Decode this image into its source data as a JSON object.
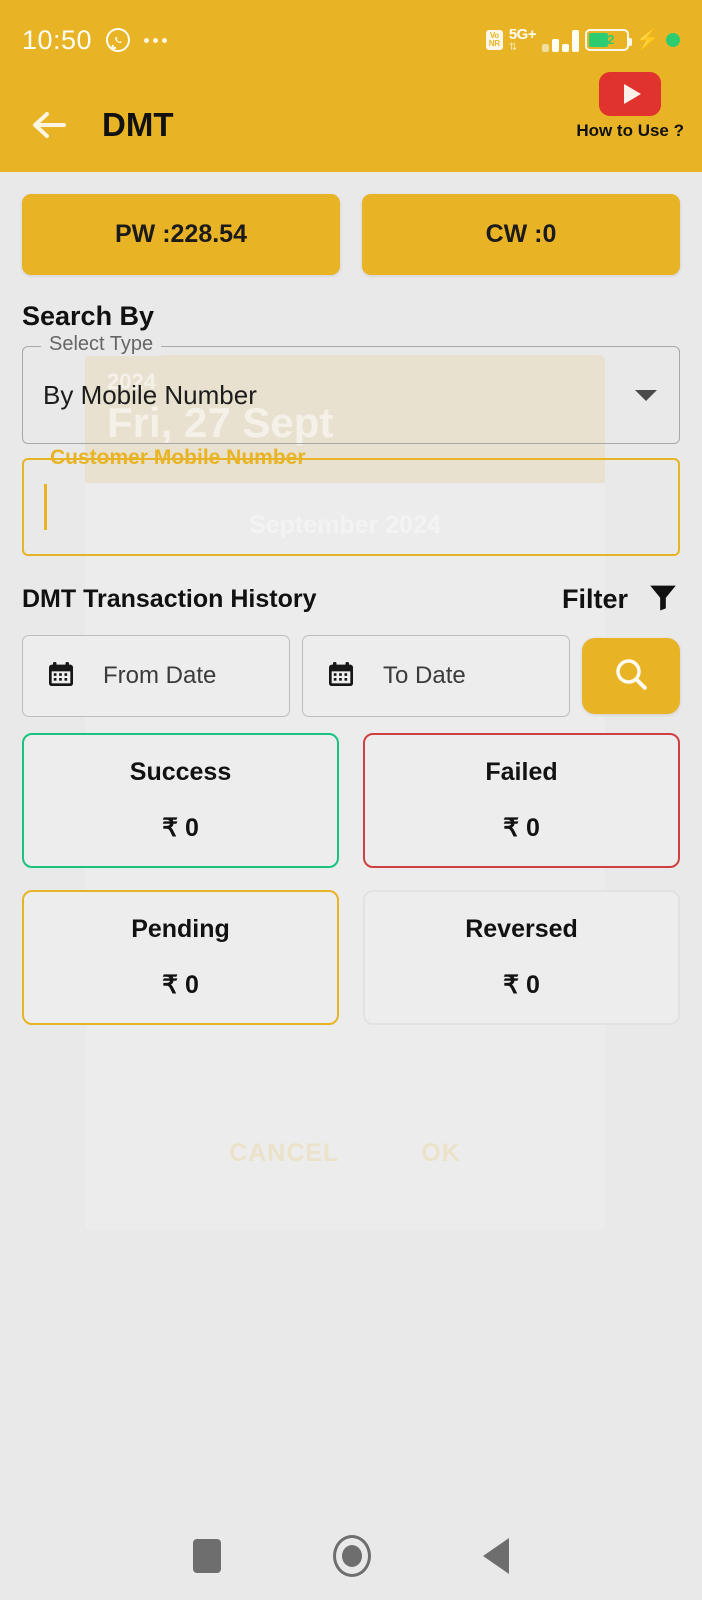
{
  "status_bar": {
    "time": "10:50",
    "whatsapp_icon": "whatsapp-icon",
    "more_icon": "more-dots-icon",
    "vonr_line1": "Vo",
    "vonr_line2": "NR",
    "network": "5G+",
    "network_arrows": "⇅",
    "battery_percent": "52",
    "charging_icon": "⚡",
    "recording_dot": "recording-dot"
  },
  "app_bar": {
    "back_icon": "back-arrow-icon",
    "title": "DMT",
    "youtube_icon": "youtube-play-icon",
    "how_to_use_label": "How to Use ?"
  },
  "wallets": [
    {
      "label": "PW :228.54",
      "name": "pw-wallet-button"
    },
    {
      "label": "CW :0",
      "name": "cw-wallet-button"
    }
  ],
  "search_section": {
    "heading": "Search By",
    "select_type": {
      "legend": "Select Type",
      "value": "By Mobile Number",
      "chevron_icon": "chevron-down-icon"
    },
    "mobile_field": {
      "legend": "Customer Mobile Number",
      "value": "",
      "placeholder": ""
    }
  },
  "history": {
    "title": "DMT Transaction History",
    "filter_label": "Filter",
    "filter_icon": "funnel-icon",
    "from_date": {
      "label": "From Date",
      "calendar_icon": "calendar-icon"
    },
    "to_date": {
      "label": "To Date",
      "calendar_icon": "calendar-icon"
    },
    "search_button_icon": "search-icon"
  },
  "stat_cards": [
    {
      "label": "Success",
      "amount": "₹ 0",
      "border": "#19c37d",
      "style": "bd-success"
    },
    {
      "label": "Failed",
      "amount": "₹ 0",
      "border": "#cf4040",
      "style": "bd-failed"
    },
    {
      "label": "Pending",
      "amount": "₹ 0",
      "border": "#e8b426",
      "style": "bd-pending"
    },
    {
      "label": "Reversed",
      "amount": "₹ 0",
      "border": "#e2e2e2",
      "style": "bd-neutral"
    }
  ],
  "ghost_dialog": {
    "year": "2024",
    "selected_date": "Fri, 27 Sept",
    "month_year": "September 2024",
    "cancel_label": "CANCEL",
    "ok_label": "OK"
  },
  "nav_bar": {
    "recents_icon": "recents-square-icon",
    "home_icon": "home-circle-icon",
    "back_icon": "back-triangle-icon"
  },
  "colors": {
    "brand_yellow": "#e8b426",
    "page_background": "#e9e9e9",
    "success_green": "#19c37d",
    "failed_red": "#cf4040",
    "youtube_red": "#e0332e"
  }
}
